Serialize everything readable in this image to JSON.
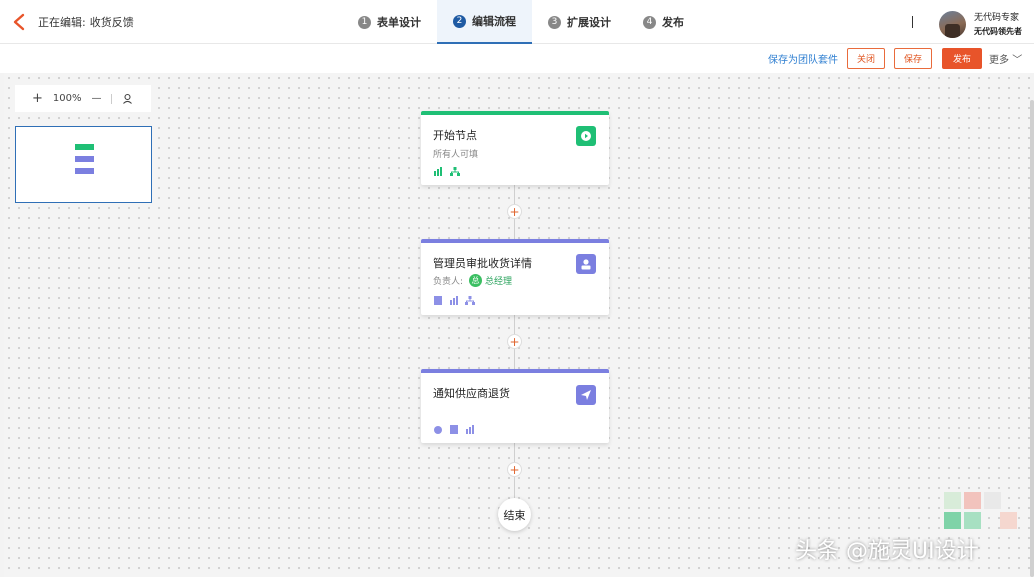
{
  "header": {
    "editing_prefix": "正在编辑:",
    "editing_name": "收货反馈",
    "steps": [
      {
        "num": "1",
        "label": "表单设计"
      },
      {
        "num": "2",
        "label": "编辑流程"
      },
      {
        "num": "3",
        "label": "扩展设计"
      },
      {
        "num": "4",
        "label": "发布"
      }
    ],
    "active_step": 1,
    "user": {
      "name": "无代码专家",
      "subtitle": "无代码领先者"
    }
  },
  "actions": {
    "save_team": "保存为团队套件",
    "close": "关闭",
    "save": "保存",
    "publish": "发布",
    "more": "更多"
  },
  "toolbar": {
    "zoom_in": "+",
    "zoom": "100%",
    "zoom_out": "—"
  },
  "nodes": [
    {
      "title": "开始节点",
      "desc": "所有人可填",
      "accent": "#1fbf75",
      "icon": "play-icon"
    },
    {
      "title": "管理员审批收货详情",
      "owner_label": "负责人:",
      "owner_initial": "总",
      "owner_name": "总经理",
      "accent": "#7b7fe0",
      "icon": "user-icon"
    },
    {
      "title": "通知供应商退货",
      "accent": "#7b7fe0",
      "icon": "send-icon"
    }
  ],
  "end_label": "结束",
  "watermark": "头条 @施灵UI设计",
  "colors": {
    "primary": "#2f6fb6",
    "accent": "#e8542a",
    "green": "#1fbf75",
    "purple": "#7b7fe0"
  }
}
